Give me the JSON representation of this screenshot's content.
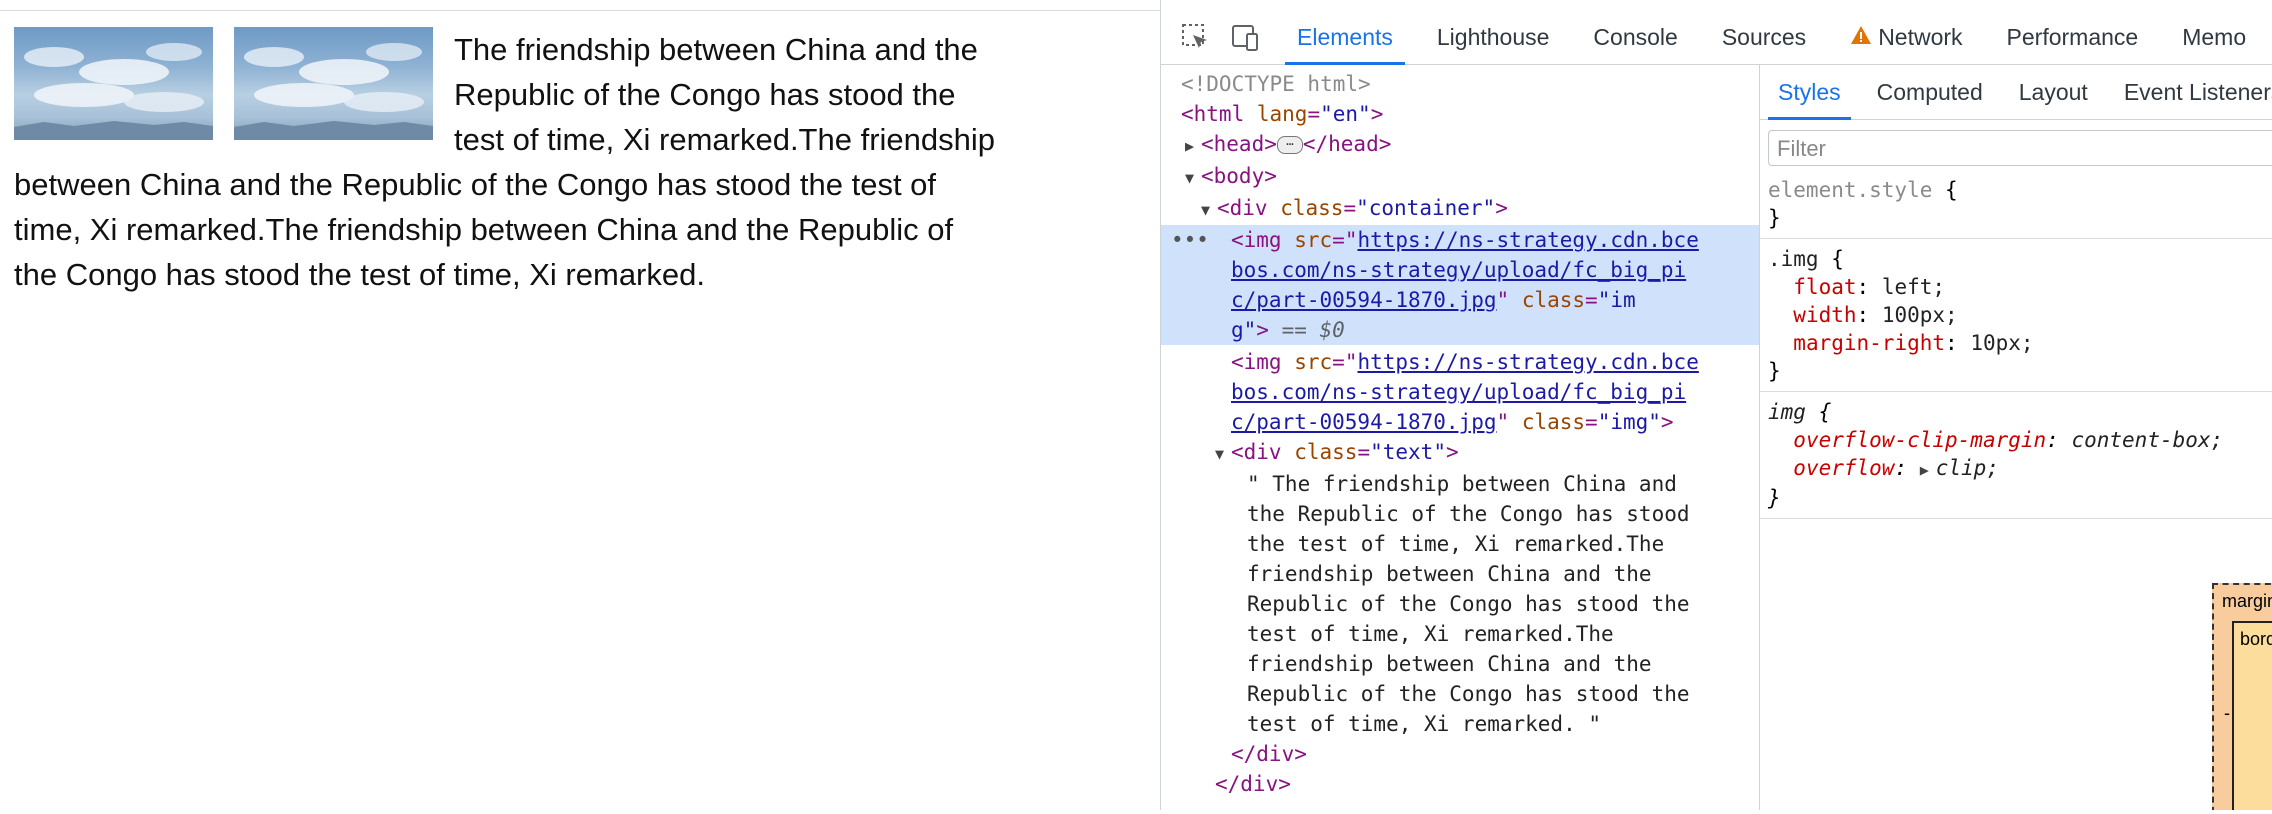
{
  "page": {
    "paragraph": "The friendship between China and the Republic of the Congo has stood the test of time, Xi remarked.The friendship between China and the Republic of the Congo has stood the test of time, Xi remarked.The friendship between China and the Republic of the Congo has stood the test of time, Xi remarked."
  },
  "devtools": {
    "tabs": [
      "Elements",
      "Lighthouse",
      "Console",
      "Sources",
      "Network",
      "Performance",
      "Memo"
    ],
    "active_tab": "Elements",
    "dom": {
      "doctype": "<!DOCTYPE html>",
      "html_open": "<html",
      "lang_attr": "lang",
      "lang_val": "\"en\"",
      "head_open": "<head>",
      "head_close": "</head>",
      "body_open": "<body>",
      "div_container_open": "<div",
      "class_attr": "class",
      "container_val": "\"container\"",
      "img_open": "<img",
      "src_attr": "src",
      "img_src_1a": "https://ns-strategy.cdn.bce",
      "img_src_1b": "bos.com/ns-strategy/upload/fc_big_pi",
      "img_src_1c": "c/part-00594-1870.jpg",
      "img_class_part1": "\"im",
      "img_class_part2": "g\"",
      "eq0": "== $0",
      "div_text_open": "<div",
      "text_val": "\"text\"",
      "text_lines": [
        "\" The friendship between China and",
        "the Republic of the Congo has stood",
        "the test of time, Xi remarked.The",
        "friendship between China and the",
        "Republic of the Congo has stood the",
        "test of time, Xi remarked.The",
        "friendship between China and the",
        "Republic of the Congo has stood the",
        "test of time, Xi remarked. \""
      ],
      "div_close": "</div>",
      "img_class_val": "\"img\""
    },
    "styles": {
      "sub_tabs": [
        "Styles",
        "Computed",
        "Layout",
        "Event Listeners"
      ],
      "active_sub_tab": "Styles",
      "filter_placeholder": "Filter",
      "element_style": "element.style",
      "rule1_selector": ".img",
      "rule1_props": [
        {
          "name": "float",
          "value": "left;"
        },
        {
          "name": "width",
          "value": "100px;"
        },
        {
          "name": "margin-right",
          "value": "10px;"
        }
      ],
      "rule2_selector": "img",
      "rule2_props": [
        {
          "name": "overflow-clip-margin",
          "value": "content-box;"
        },
        {
          "name": "overflow",
          "value": "clip;"
        }
      ],
      "box_margin_label": "margin",
      "box_border_label": "border",
      "box_dash": "-"
    }
  }
}
